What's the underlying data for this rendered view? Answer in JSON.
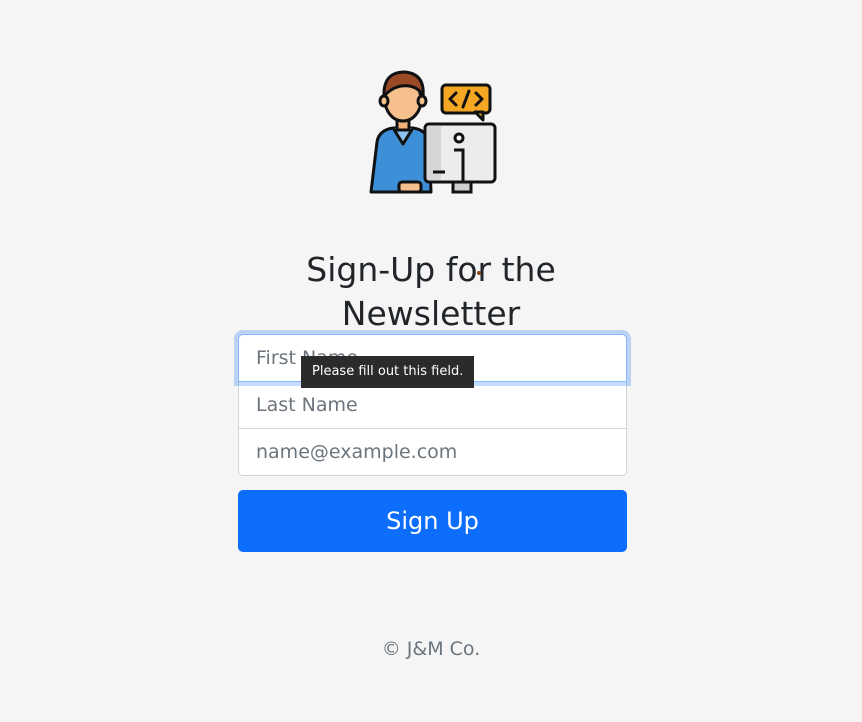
{
  "header": {
    "title_line1": "Sign-Up for the",
    "title_line2": "Newsletter",
    "logo_icon": "developer-at-computer-icon"
  },
  "form": {
    "first_name_placeholder": "First Name",
    "last_name_placeholder": "Last Name",
    "email_placeholder": "name@example.com",
    "first_name_value": "",
    "last_name_value": "",
    "email_value": "",
    "submit_label": "Sign Up"
  },
  "validation": {
    "tooltip_text": "Please fill out this field."
  },
  "footer": {
    "copyright": "© J&M Co."
  },
  "colors": {
    "background": "#f5f5f5",
    "primary": "#0d6efd",
    "focus_ring": "#86b7fe",
    "tooltip_bg": "#2b2b2b"
  }
}
